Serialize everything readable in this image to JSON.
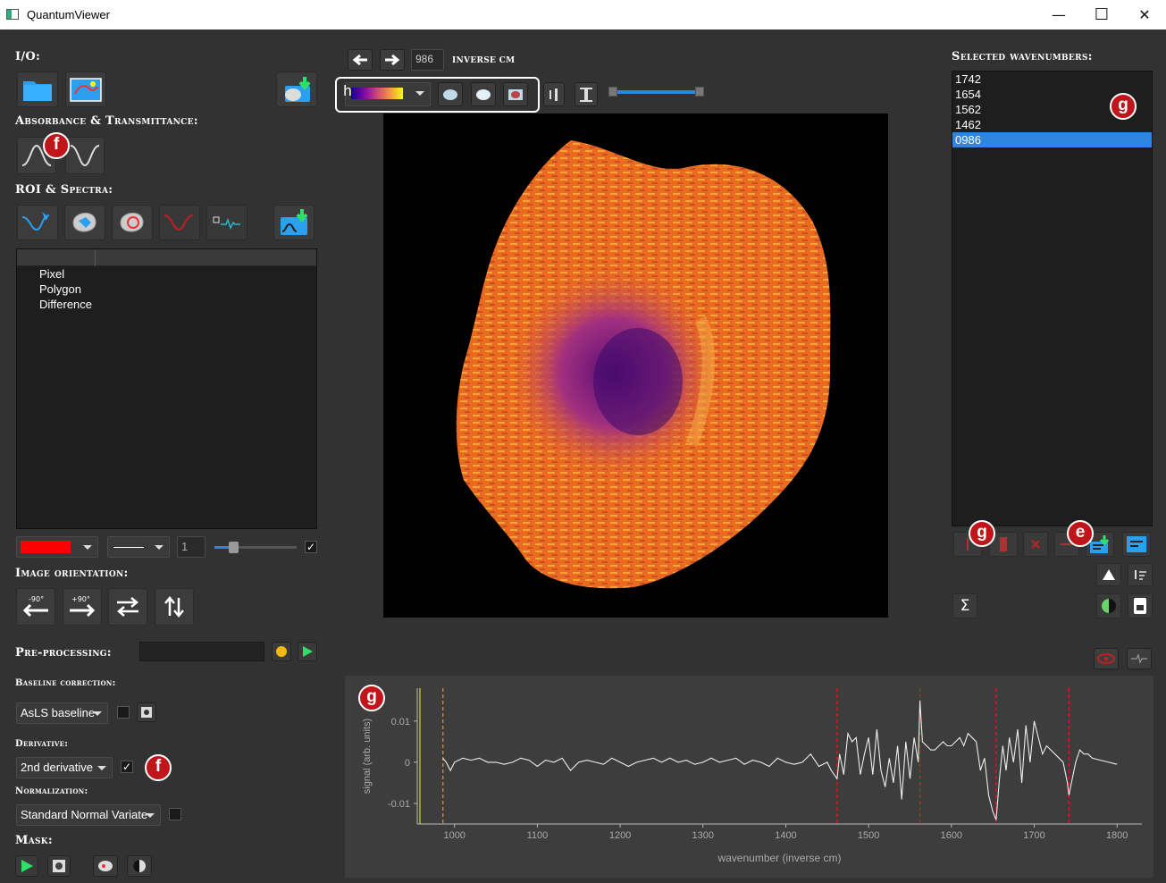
{
  "window": {
    "title": "QuantumViewer",
    "minimize": "—",
    "maximize": "☐",
    "close": "✕"
  },
  "left": {
    "io_header": "I/O:",
    "abs_header": "Absorbance & Transmittance:",
    "roi_header": "ROI & Spectra:",
    "roi_columns": [
      "",
      ""
    ],
    "roi_items": [
      "Pixel",
      "Polygon",
      "Difference"
    ],
    "line_width": "1",
    "orientation_header": "Image orientation:",
    "rot_minus": "-90°",
    "rot_plus": "+90°",
    "preproc_header": "Pre-processing:",
    "baseline_header": "Baseline correction:",
    "baseline_value": "AsLS baseline",
    "derivative_header": "Derivative:",
    "derivative_value": "2nd derivative",
    "derivative_checked": "✓",
    "roi_enabled_checked": "✓",
    "normalization_header": "Normalization:",
    "normalization_value": "Standard Normal Variate",
    "mask_header": "Mask:"
  },
  "center": {
    "wavenumber_value": "986",
    "wavenumber_unit": "INVERSE CM",
    "colormap_label": "h"
  },
  "right": {
    "selected_header": "Selected wavenumbers:",
    "wavenumbers": [
      "1742",
      "1654",
      "1562",
      "1462",
      "0986"
    ],
    "selected_index": 4,
    "sum_symbol": "Σ"
  },
  "badges": {
    "f1": "f",
    "f2": "f",
    "g1": "g",
    "g2": "g",
    "g3": "g",
    "e1": "e"
  },
  "colors": {
    "accent_blue": "#2f86e0",
    "badge_red": "#c0161b",
    "roi_color": "#ff0000",
    "orange_dashed": "#ff7f0e",
    "red_dashed": "#e8141c",
    "yellow_line": "#c8c832"
  },
  "chart_data": {
    "type": "line",
    "xlabel": "wavenumber (inverse cm)",
    "ylabel": "signal (arb. units)",
    "xlim": [
      955,
      1830
    ],
    "ylim": [
      -0.015,
      0.018
    ],
    "xticks": [
      1000,
      1100,
      1200,
      1300,
      1400,
      1500,
      1600,
      1700,
      1800
    ],
    "yticks": [
      0.01,
      0,
      -0.01
    ],
    "ytick_labels": [
      "0.01",
      "0",
      "-0.01"
    ],
    "grid": false,
    "series": [
      {
        "x": [
          986,
          990,
          995,
          1000,
          1010,
          1020,
          1030,
          1040,
          1050,
          1060,
          1070,
          1080,
          1090,
          1100,
          1110,
          1120,
          1130,
          1140,
          1150,
          1160,
          1170,
          1180,
          1190,
          1200,
          1210,
          1220,
          1230,
          1240,
          1250,
          1260,
          1270,
          1280,
          1290,
          1300,
          1310,
          1320,
          1330,
          1340,
          1350,
          1360,
          1370,
          1380,
          1390,
          1400,
          1410,
          1420,
          1430,
          1440,
          1450,
          1455,
          1462,
          1465,
          1470,
          1475,
          1480,
          1485,
          1490,
          1495,
          1500,
          1505,
          1510,
          1515,
          1520,
          1525,
          1530,
          1535,
          1540,
          1545,
          1550,
          1555,
          1560,
          1562,
          1565,
          1570,
          1575,
          1580,
          1585,
          1590,
          1595,
          1600,
          1605,
          1610,
          1615,
          1620,
          1625,
          1630,
          1635,
          1640,
          1645,
          1650,
          1654,
          1658,
          1662,
          1666,
          1670,
          1675,
          1680,
          1685,
          1690,
          1695,
          1700,
          1705,
          1710,
          1715,
          1720,
          1725,
          1730,
          1735,
          1740,
          1742,
          1746,
          1750,
          1755,
          1760,
          1765,
          1770,
          1780,
          1790,
          1800
        ],
        "y": [
          0.001,
          0.0,
          -0.002,
          0.0,
          0.001,
          0.0005,
          0.001,
          0.0,
          0.0,
          -0.0005,
          0.0,
          0.001,
          0.0005,
          -0.001,
          0.0005,
          0.0,
          0.001,
          -0.002,
          0.0,
          0.0005,
          0.0,
          -0.0005,
          0.001,
          0.0,
          -0.001,
          0.0,
          0.0005,
          0.001,
          0.0,
          0.001,
          0.0,
          0.0005,
          -0.0005,
          0.0,
          0.001,
          0.0,
          0.0005,
          0.001,
          -0.0005,
          0.0005,
          0.0,
          -0.001,
          0.001,
          0.0,
          -0.0005,
          0.0,
          0.002,
          -0.001,
          0.0,
          -0.002,
          -0.004,
          0.002,
          -0.003,
          0.007,
          0.005,
          0.006,
          -0.003,
          0.002,
          0.006,
          -0.003,
          0.008,
          -0.002,
          -0.006,
          0.001,
          -0.005,
          0.004,
          -0.009,
          0.005,
          -0.004,
          0.006,
          0.0,
          0.015,
          0.005,
          0.004,
          0.003,
          0.003,
          0.004,
          0.005,
          0.004,
          0.004,
          0.005,
          0.006,
          0.004,
          0.007,
          0.006,
          0.005,
          -0.002,
          0.001,
          -0.008,
          -0.012,
          -0.014,
          -0.004,
          0.004,
          -0.002,
          0.006,
          0.0,
          0.008,
          -0.005,
          0.009,
          0.0,
          0.01,
          0.006,
          0.002,
          0.004,
          0.003,
          0.002,
          0.001,
          0.0,
          -0.005,
          -0.008,
          -0.004,
          0.0,
          0.003,
          0.002,
          0.002,
          0.001,
          0.0005,
          0.0,
          -0.0005
        ]
      }
    ],
    "vlines_solid": [
      {
        "x": 955,
        "color": "#c8c832"
      }
    ],
    "vlines_dashed": [
      {
        "x": 986,
        "color": "#ff7f0e"
      },
      {
        "x": 1462,
        "color": "#e8141c"
      },
      {
        "x": 1562,
        "color": "#e8141c"
      },
      {
        "x": 1654,
        "color": "#e8141c"
      },
      {
        "x": 1742,
        "color": "#e8141c"
      }
    ]
  }
}
